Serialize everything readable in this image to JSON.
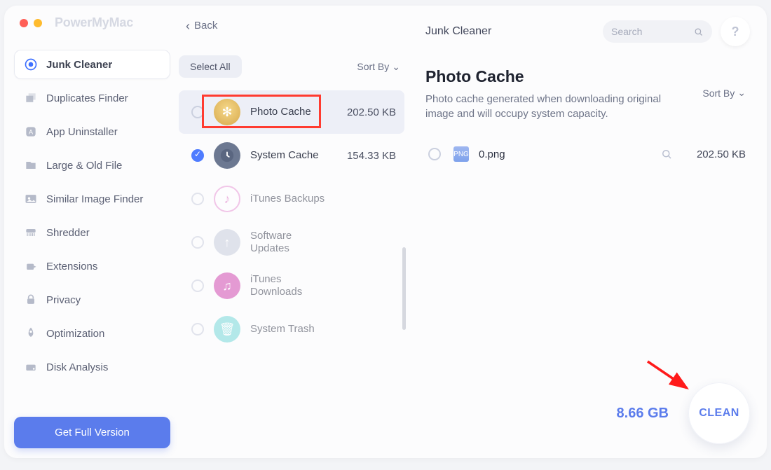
{
  "brand": "PowerMyMac",
  "back_label": "Back",
  "sidebar": {
    "items": [
      {
        "label": "Junk Cleaner"
      },
      {
        "label": "Duplicates Finder"
      },
      {
        "label": "App Uninstaller"
      },
      {
        "label": "Large & Old File"
      },
      {
        "label": "Similar Image Finder"
      },
      {
        "label": "Shredder"
      },
      {
        "label": "Extensions"
      },
      {
        "label": "Privacy"
      },
      {
        "label": "Optimization"
      },
      {
        "label": "Disk Analysis"
      }
    ]
  },
  "cta_label": "Get Full Version",
  "center": {
    "select_all": "Select All",
    "sort_by": "Sort By",
    "rows": [
      {
        "label": "Photo Cache",
        "size": "202.50 KB"
      },
      {
        "label": "System Cache",
        "size": "154.33 KB"
      },
      {
        "label": "iTunes Backups",
        "size": ""
      },
      {
        "label": "Software Updates",
        "size": ""
      },
      {
        "label": "iTunes Downloads",
        "size": ""
      },
      {
        "label": "System Trash",
        "size": ""
      }
    ]
  },
  "right": {
    "page_title": "Junk Cleaner",
    "search_placeholder": "Search",
    "help": "?",
    "heading": "Photo Cache",
    "description": "Photo cache generated when downloading original image and will occupy system capacity.",
    "sort_by": "Sort By",
    "file": {
      "name": "0.png",
      "size": "202.50 KB"
    },
    "total": "8.66 GB",
    "clean": "CLEAN"
  }
}
